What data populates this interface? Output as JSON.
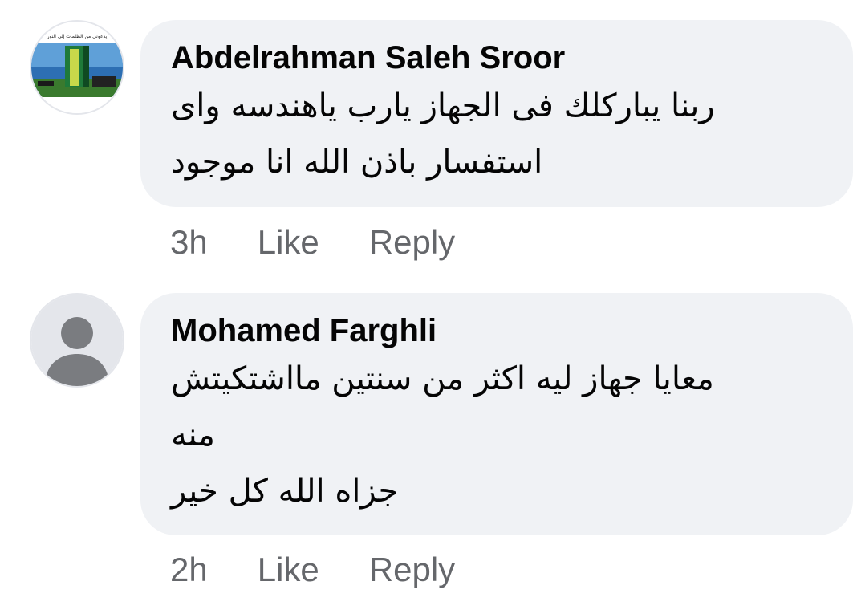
{
  "comments": [
    {
      "author": "Abdelrahman Saleh Sroor",
      "avatar_caption": "يدعوني من الظلمات إلى النور",
      "lines": [
        "ربنا يباركلك فى الجهاز يارب ياهندسه واى",
        "استفسار باذن الله انا موجود"
      ],
      "time": "3h",
      "like_label": "Like",
      "reply_label": "Reply"
    },
    {
      "author": "Mohamed Farghli",
      "lines": [
        "معايا جهاز ليه اكثر من سنتين مااشتكيتش",
        "منه",
        "جزاه الله كل خير"
      ],
      "time": "2h",
      "like_label": "Like",
      "reply_label": "Reply"
    }
  ],
  "colors": {
    "bubble": "#f0f2f5",
    "text": "#050505",
    "secondary_text": "#65676b"
  }
}
